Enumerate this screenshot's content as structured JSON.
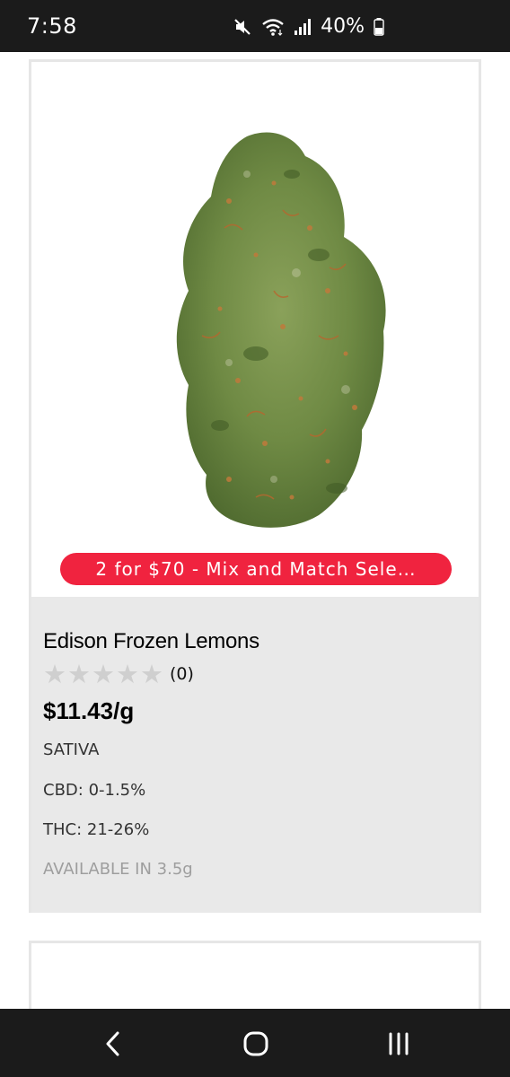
{
  "status_bar": {
    "time": "7:58",
    "battery": "40%",
    "icons": [
      "mute-icon",
      "wifi-icon",
      "signal-icon",
      "battery-icon"
    ]
  },
  "product": {
    "image": "cannabis-bud-image",
    "promo": "2 for $70 - Mix and Match Sele…",
    "name": "Edison Frozen Lemons",
    "rating_stars": 0,
    "rating_max": 5,
    "review_count": "(0)",
    "price": "$11.43/g",
    "strain": "SATIVA",
    "cbd": "CBD: 0-1.5%",
    "thc": "THC: 21-26%",
    "availability": "AVAILABLE IN 3.5g"
  },
  "colors": {
    "promo_badge": "#f0233f",
    "info_background": "#e9e9e9",
    "star_empty": "#cfcfcf",
    "system_bars": "#1b1b1b"
  },
  "nav_bar": {
    "buttons": [
      "back-icon",
      "home-icon",
      "recents-icon"
    ]
  }
}
